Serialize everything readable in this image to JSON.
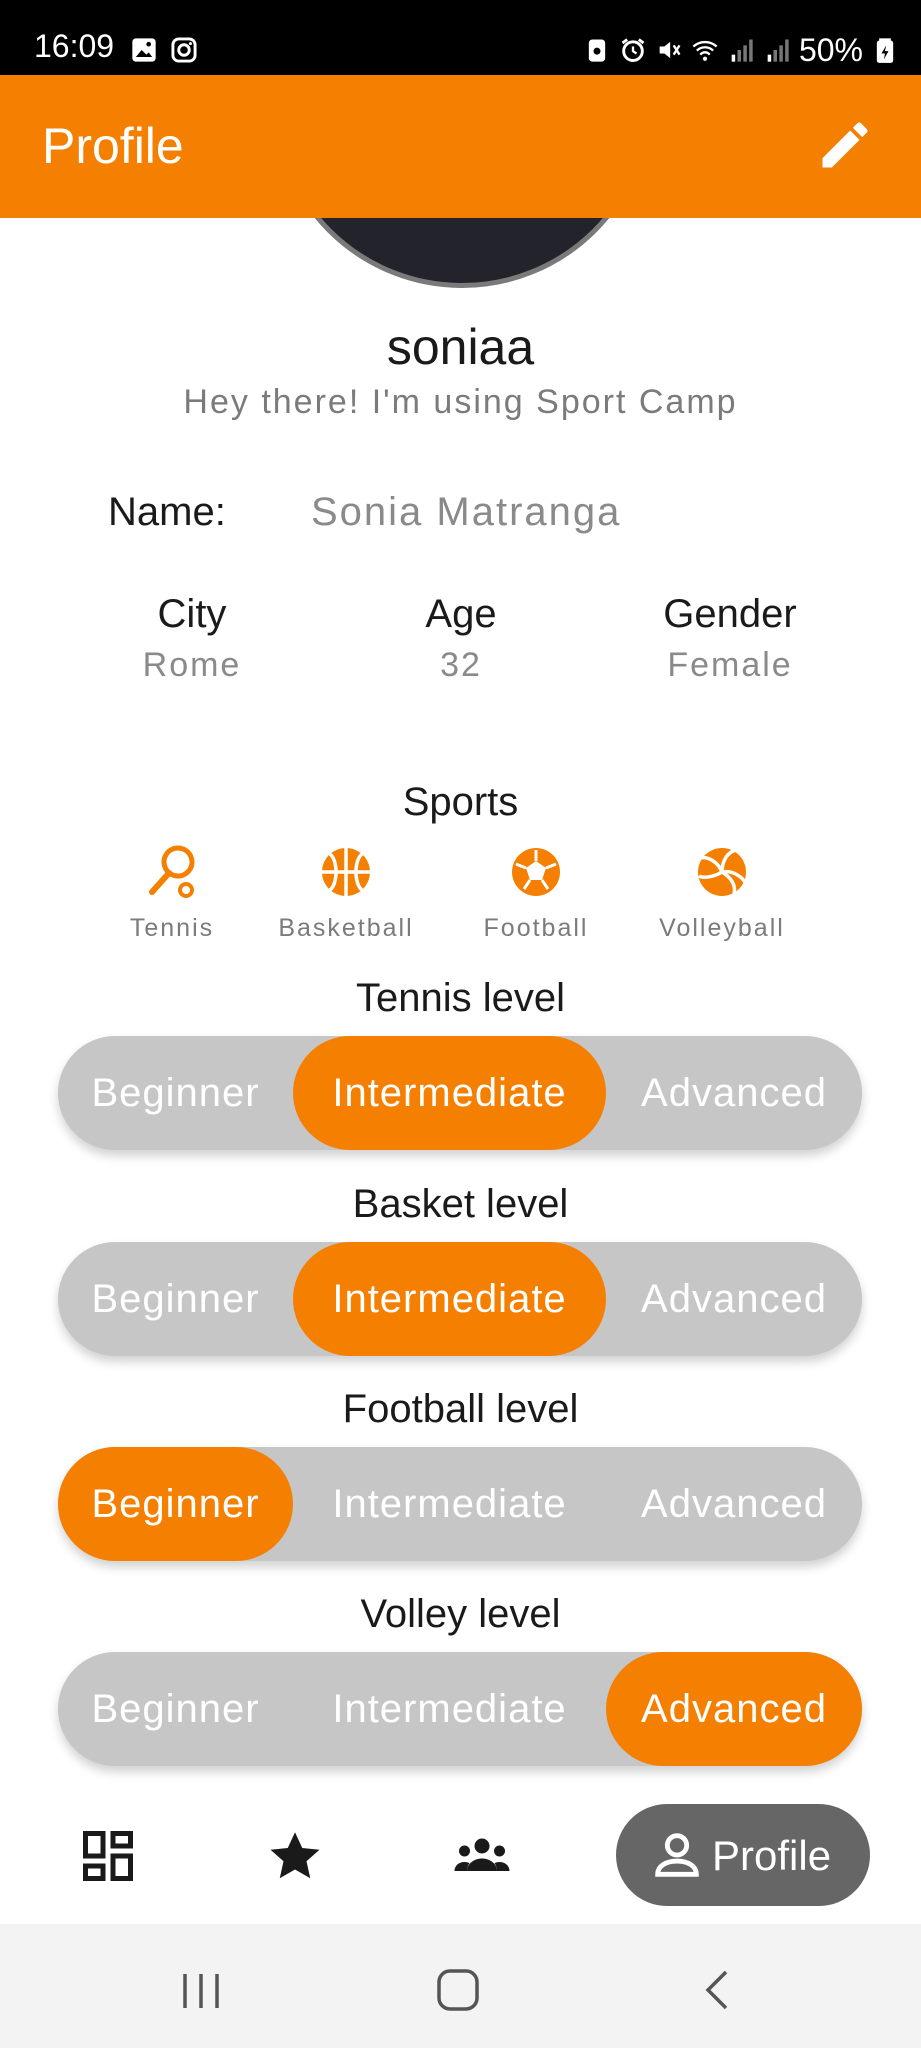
{
  "status_bar": {
    "time": "16:09",
    "battery": "50%"
  },
  "app_bar": {
    "title": "Profile"
  },
  "profile": {
    "username": "soniaa",
    "status_message": "Hey there! I'm using Sport Camp",
    "name_label": "Name:",
    "name_value": "Sonia Matranga",
    "city_label": "City",
    "city_value": "Rome",
    "age_label": "Age",
    "age_value": "32",
    "gender_label": "Gender",
    "gender_value": "Female"
  },
  "sports": {
    "title": "Sports",
    "items": [
      {
        "label": "Tennis",
        "icon": "tennis-racket-icon"
      },
      {
        "label": "Basketball",
        "icon": "basketball-icon"
      },
      {
        "label": "Football",
        "icon": "football-icon"
      },
      {
        "label": "Volleyball",
        "icon": "volleyball-icon"
      }
    ]
  },
  "levels": [
    {
      "title": "Tennis level",
      "options": [
        "Beginner",
        "Intermediate",
        "Advanced"
      ],
      "selected": "Intermediate"
    },
    {
      "title": "Basket level",
      "options": [
        "Beginner",
        "Intermediate",
        "Advanced"
      ],
      "selected": "Intermediate"
    },
    {
      "title": "Football level",
      "options": [
        "Beginner",
        "Intermediate",
        "Advanced"
      ],
      "selected": "Beginner"
    },
    {
      "title": "Volley level",
      "options": [
        "Beginner",
        "Intermediate",
        "Advanced"
      ],
      "selected": "Advanced"
    }
  ],
  "bottom_nav": {
    "items": [
      {
        "icon": "dashboard-icon"
      },
      {
        "icon": "star-icon"
      },
      {
        "icon": "groups-icon"
      },
      {
        "icon": "person-icon",
        "label": "Profile",
        "active": true
      }
    ]
  },
  "colors": {
    "accent": "#f57f00",
    "segment_bg": "#c6c6c6",
    "nav_active_bg": "#666666"
  }
}
